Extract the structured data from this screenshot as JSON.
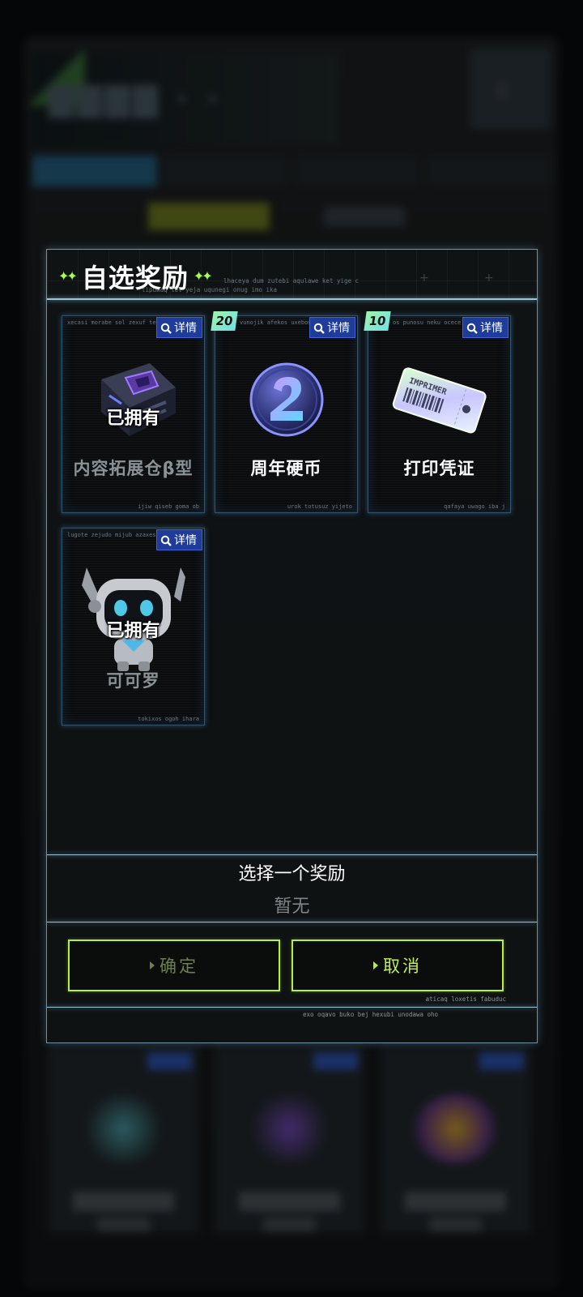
{
  "dialog": {
    "title": "自选奖励",
    "header_tiny_1": "lhaceya dum zutebi aqulawe ket yige c",
    "header_tiny_2": "tipuwaq lel yeja uqunegi onug imo ika",
    "cards": [
      {
        "name": "内容拓展仓β型",
        "owned": "已拥有",
        "detail": "详情",
        "tiny_top": "xecasi morabe sol zexuf tel",
        "tiny_bottom": "ijiw qiseb goma ob",
        "count": "",
        "name_dim": true
      },
      {
        "name": "周年硬币",
        "owned": "",
        "detail": "详情",
        "tiny_top": "vunojik afekos uxebos",
        "tiny_bottom": "urok totusuz yijeto",
        "count": "20",
        "name_dim": false
      },
      {
        "name": "打印凭证",
        "owned": "",
        "detail": "详情",
        "tiny_top": "os punosu neku ocece o",
        "tiny_bottom": "qafaya uwago iba j",
        "count": "10",
        "name_dim": false
      },
      {
        "name": "可可罗",
        "owned": "已拥有",
        "detail": "详情",
        "tiny_top": "lugote zejudo mijub azaxes",
        "tiny_bottom": "tokixos ogoh ihara",
        "count": "",
        "name_dim": true
      }
    ],
    "selection_prompt": "选择一个奖励",
    "selection_value": "暂无",
    "confirm_label": "确定",
    "cancel_label": "取消",
    "bottom_tiny_1": "aticaq loxetis fabuduc",
    "bottom_tiny_2": "exo oqavo buko bej hexubi unodawa oho"
  },
  "colors": {
    "accent_green": "#b6f03b",
    "detail_blue": "#1f3c9a",
    "frame_line": "#9cc3d6"
  }
}
